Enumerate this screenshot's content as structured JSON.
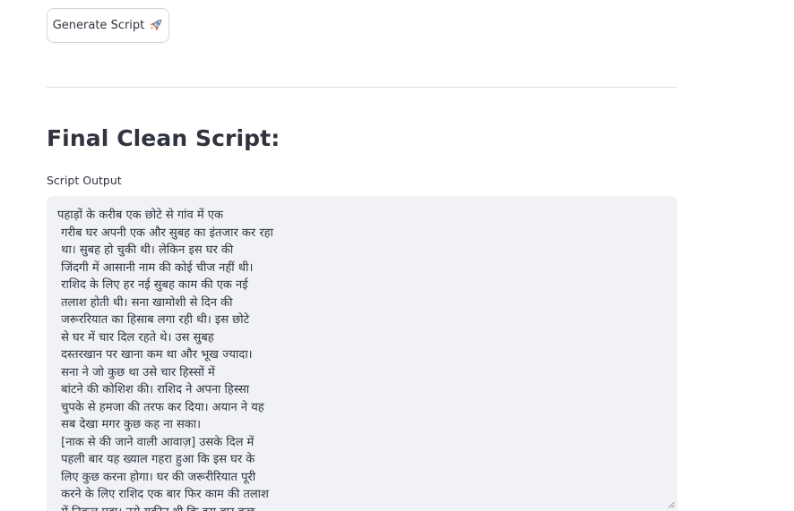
{
  "toolbar": {
    "generate_label": "Generate Script",
    "generate_icon": "rocket-icon"
  },
  "section": {
    "title": "Final Clean Script:"
  },
  "output": {
    "label": "Script Output",
    "lines": [
      "पहाड़ों के करीब एक छोटे से गांव में एक",
      " गरीब घर अपनी एक और सुबह का इंतजार कर रहा",
      " था। सुबह हो चुकी थी। लेकिन इस घर की",
      " जिंदगी में आसानी नाम की कोई चीज नहीं थी।",
      " राशिद के लिए हर नई सुबह काम की एक नई",
      " तलाश होती थी। सना खामोशी से दिन की",
      " जरूररियात का हिसाब लगा रही थी। इस छोटे",
      " से घर में चार दिल रहते थे। उस सुबह",
      " दस्तरखान पर खाना कम था और भूख ज्यादा।",
      " सना ने जो कुछ था उसे चार हिस्सों में",
      " बांटने की कोशिश की। राशिद ने अपना हिस्सा",
      " चुपके से हमजा की तरफ कर दिया। अयान ने यह",
      " सब देखा मगर कुछ कह ना सका।",
      " [नाक से की जाने वाली आवाज़] उसके दिल में",
      " पहली बार यह ख्याल गहरा हुआ कि इस घर के",
      " लिए कुछ करना होगा। घर की जरूरीरियात पूरी",
      " करने के लिए राशिद एक बार फिर काम की तलाश",
      " में निकल पड़ा। उसे यकीन थी कि इस बार कुछ"
    ]
  }
}
